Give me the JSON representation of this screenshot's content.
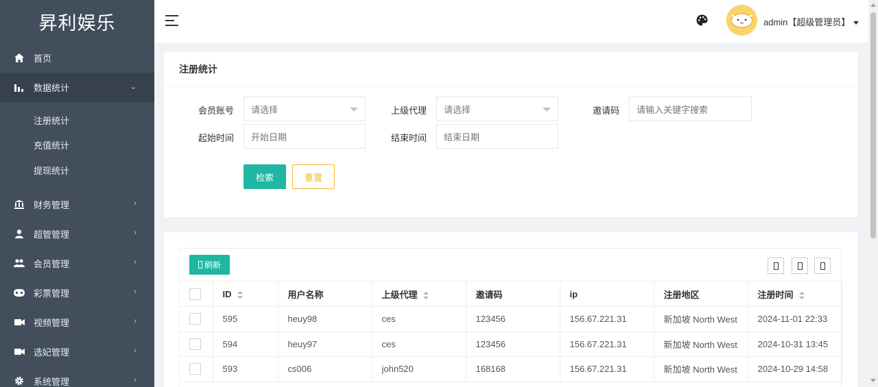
{
  "brand": "昇利娱乐",
  "sidebar": {
    "items": [
      {
        "label": "首页",
        "icon": "home-icon"
      },
      {
        "label": "数据统计",
        "icon": "bar-chart-icon",
        "expanded": true
      },
      {
        "label": "财务管理",
        "icon": "bank-icon"
      },
      {
        "label": "超管管理",
        "icon": "user-icon"
      },
      {
        "label": "会员管理",
        "icon": "users-icon"
      },
      {
        "label": "彩票管理",
        "icon": "gamepad-icon"
      },
      {
        "label": "视频管理",
        "icon": "video-icon"
      },
      {
        "label": "选妃管理",
        "icon": "video-icon"
      },
      {
        "label": "系统管理",
        "icon": "gear-icon"
      }
    ],
    "subitems": [
      "注册统计",
      "充值统计",
      "提现统计"
    ]
  },
  "header": {
    "user": "admin【超级管理员】"
  },
  "search_panel": {
    "title": "注册统计",
    "fields": {
      "member_label": "会员账号",
      "member_placeholder": "请选择",
      "agent_label": "上级代理",
      "agent_placeholder": "请选择",
      "invite_label": "邀请码",
      "invite_placeholder": "请输入关键字搜索",
      "start_label": "起始时间",
      "start_placeholder": "开始日期",
      "end_label": "结束时间",
      "end_placeholder": "结束日期"
    },
    "search_label": "检索",
    "reset_label": "重置"
  },
  "table": {
    "refresh_label": "刷新",
    "refresh_icon": "refresh-icon",
    "columns": [
      "ID",
      "用户名称",
      "上级代理",
      "邀请码",
      "ip",
      "注册地区",
      "注册时间"
    ],
    "rows": [
      [
        "595",
        "heuy98",
        "ces",
        "123456",
        "156.67.221.31",
        "新加坡 North West",
        "2024-11-01 22:33"
      ],
      [
        "594",
        "heuy97",
        "ces",
        "123456",
        "156.67.221.31",
        "新加坡 North West",
        "2024-10-31 13:45"
      ],
      [
        "593",
        "cs006",
        "john520",
        "168168",
        "156.67.221.31",
        "新加坡 North West",
        "2024-10-29 14:58"
      ]
    ]
  },
  "colors": {
    "sidebar": "#434e5c",
    "primary": "#1fb6a2",
    "warning": "#f5b729"
  }
}
